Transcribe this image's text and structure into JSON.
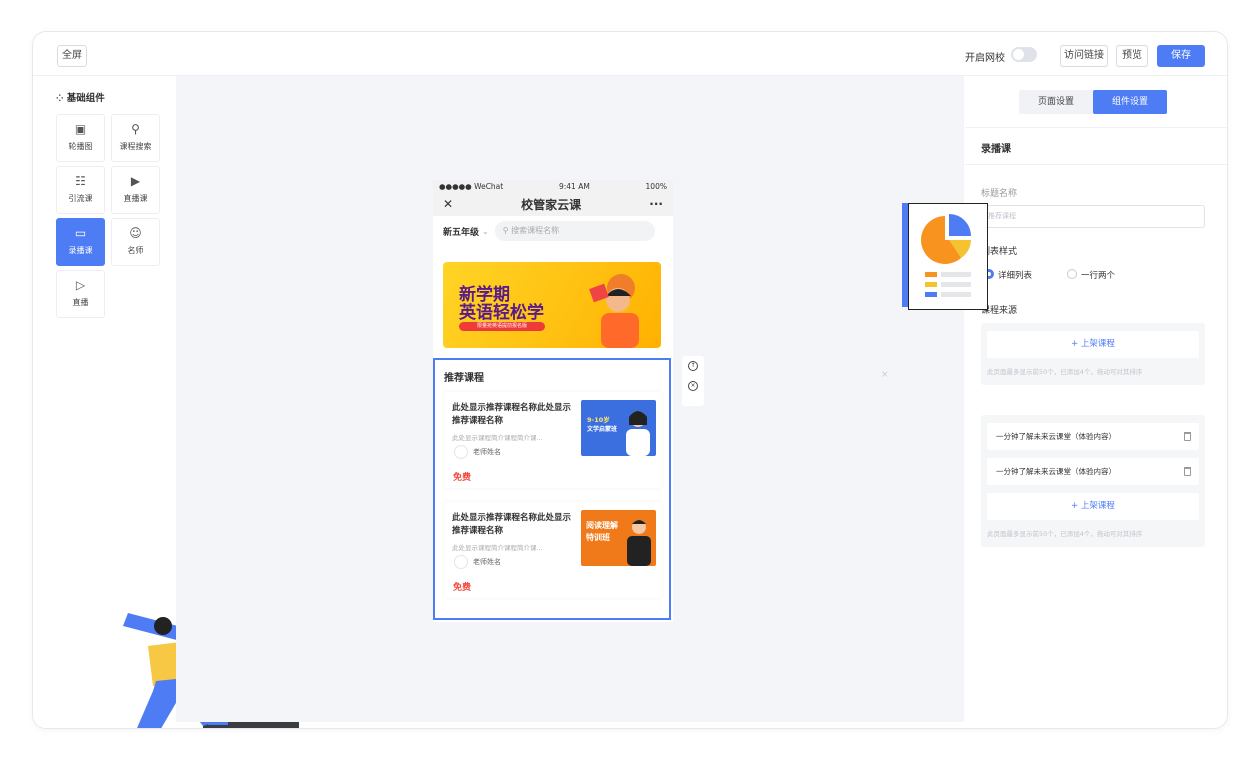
{
  "topbar": {
    "fullscreen": "全屏",
    "open_school": "开启网校",
    "visit_link": "访问链接",
    "preview": "预览",
    "save": "保存"
  },
  "left_panel": {
    "title": "基础组件",
    "items": [
      {
        "label": "轮播图",
        "icon": "image-icon"
      },
      {
        "label": "课程搜索",
        "icon": "search-icon"
      },
      {
        "label": "引流课",
        "icon": "list-icon"
      },
      {
        "label": "直播课",
        "icon": "live-icon"
      },
      {
        "label": "录播课",
        "icon": "record-icon"
      },
      {
        "label": "名师",
        "icon": "teacher-icon"
      },
      {
        "label": "直播",
        "icon": "play-icon"
      }
    ]
  },
  "phone": {
    "carrier": "●●●●● WeChat",
    "time": "9:41 AM",
    "battery": "100%",
    "title": "校管家云课",
    "grade": "新五年级",
    "search_placeholder": "搜索课程名称",
    "banner": {
      "line1": "新学期",
      "line2": "英语轻松学",
      "pill": "限量抢英语提前报名版"
    },
    "recommend_title": "推荐课程",
    "courses": [
      {
        "name": "此处显示推荐课程名称此处显示推荐课程名称",
        "desc": "此处显示课程简介课程简介课...",
        "teacher": "老师姓名",
        "price": "免费",
        "thumb_line1": "9-10岁",
        "thumb_line2": "文学启蒙班",
        "thumb_color": "#3b6fe0"
      },
      {
        "name": "此处显示推荐课程名称此处显示推荐课程名称",
        "desc": "此处显示课程简介课程简介课...",
        "teacher": "老师姓名",
        "price": "免费",
        "thumb_line1": "阅读理解",
        "thumb_line2": "特训班",
        "thumb_color": "#f07a1a"
      }
    ]
  },
  "right_panel": {
    "tab_page": "页面设置",
    "tab_component": "组件设置",
    "section_title": "录播课",
    "title_label": "标题名称",
    "title_placeholder": "推荐课程",
    "list_style_label": "列表样式",
    "option_detail": "详细列表",
    "option_two": "一行两个",
    "source_label": "课程来源",
    "add_course": "+ 上架课程",
    "hint": "此页面最多显示前50个，已添加4个，拖动可对其排序",
    "course_items": [
      "一分钟了解未来云课堂（体验内容）",
      "一分钟了解未来云课堂（体验内容）"
    ]
  },
  "colors": {
    "accent": "#4d7cf4",
    "price": "#f24a3e",
    "banner": "#ffc010"
  }
}
